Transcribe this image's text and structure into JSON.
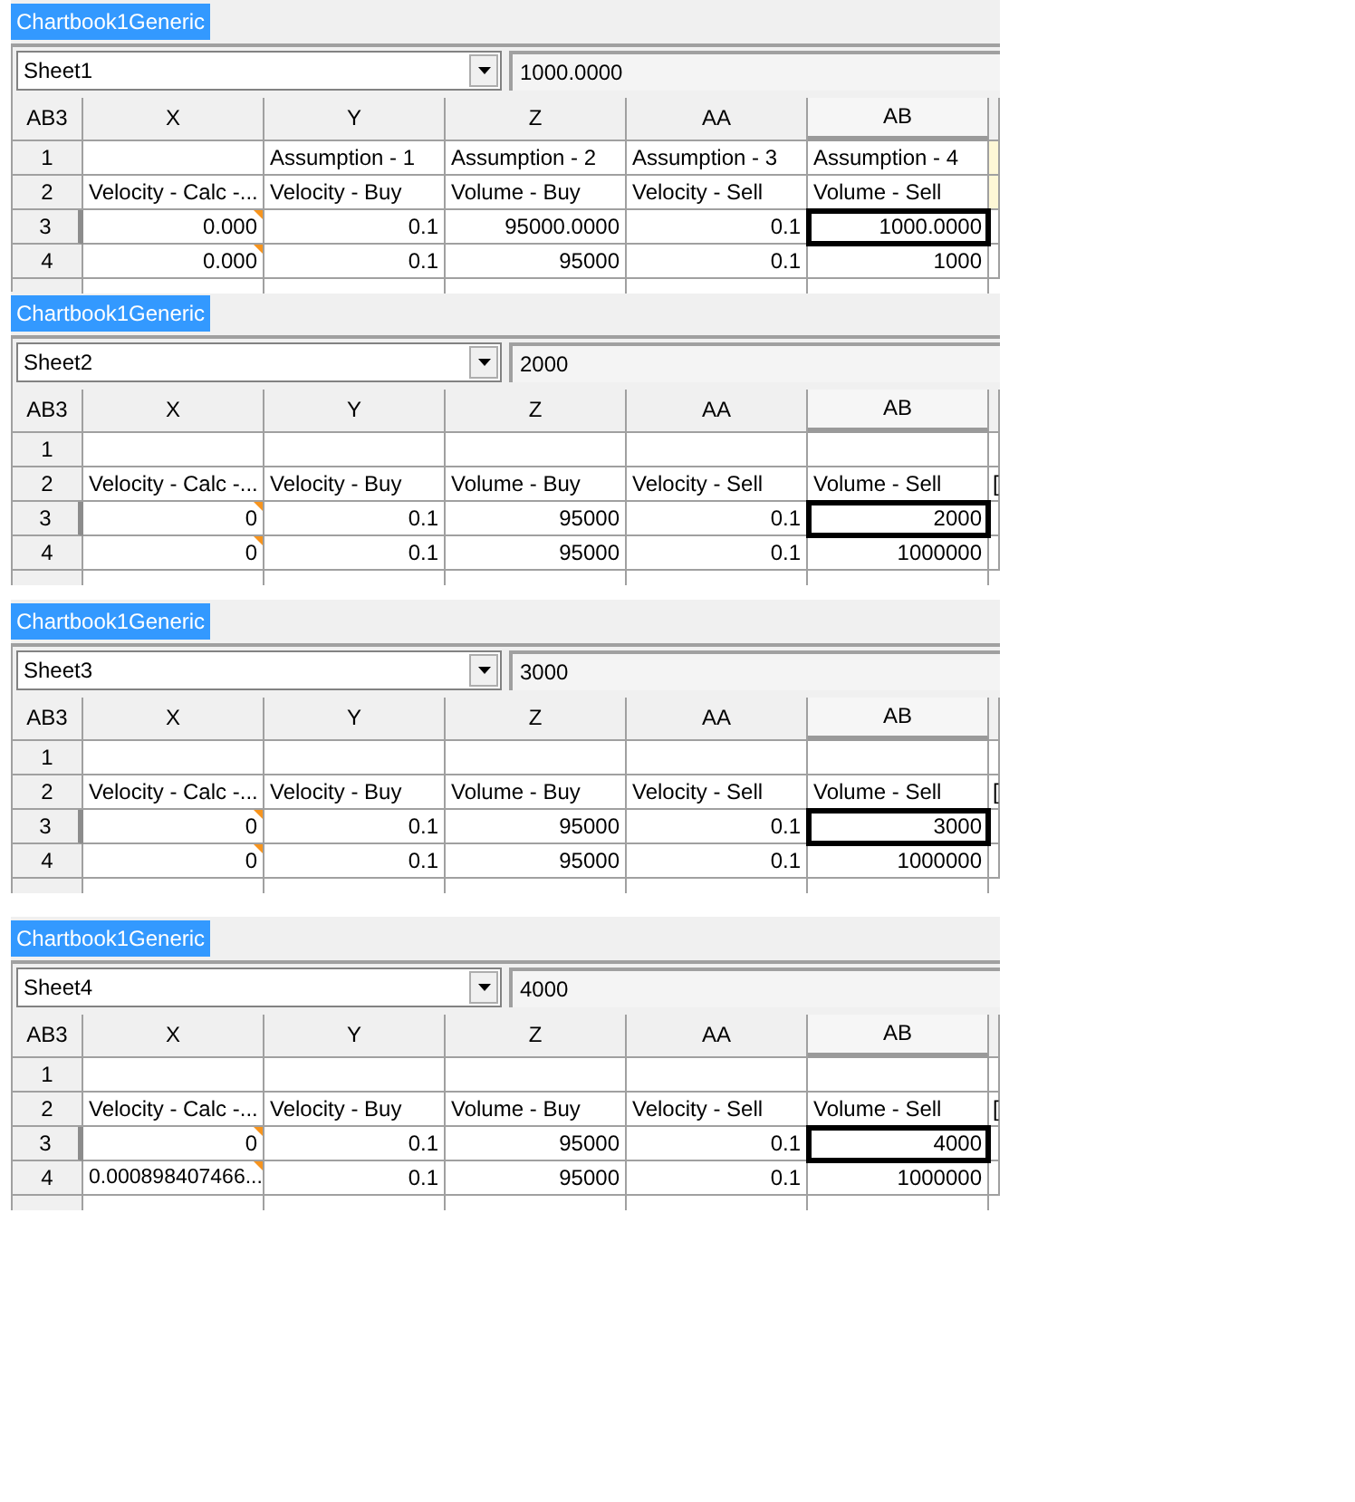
{
  "panels": [
    {
      "tab": {
        "label": "Chartbook1Generic",
        "selected": true
      },
      "sheet_selector": {
        "value": "Sheet1"
      },
      "formula_bar": {
        "value": "1000.0000"
      },
      "grid": {
        "cell_reference": "AB3",
        "columns": [
          {
            "label": "X",
            "selected": false
          },
          {
            "label": "Y",
            "selected": false
          },
          {
            "label": "Z",
            "selected": false
          },
          {
            "label": "AA",
            "selected": false
          },
          {
            "label": "AB",
            "selected": true
          },
          {
            "selected": false
          }
        ],
        "rows": [
          {
            "label": "1",
            "kind": "text",
            "selected": false,
            "cells": [
              {
                "marked": false
              },
              {
                "text": "Assumption - 1",
                "marked": false
              },
              {
                "text": "Assumption - 2",
                "marked": false
              },
              {
                "text": "Assumption - 3",
                "marked": false
              },
              {
                "text": "Assumption - 4",
                "marked": false
              },
              {
                "marked": false,
                "color": "#fdf7d6"
              }
            ]
          },
          {
            "label": "2",
            "kind": "text",
            "selected": false,
            "cells": [
              {
                "text": "Velocity - Calc -...",
                "marked": false
              },
              {
                "text": "Velocity - Buy",
                "marked": false
              },
              {
                "text": "Volume - Buy",
                "marked": false
              },
              {
                "text": "Velocity - Sell",
                "marked": false
              },
              {
                "text": "Volume - Sell",
                "marked": false
              },
              {
                "marked": false,
                "color": "#fdf7d6"
              }
            ]
          },
          {
            "label": "3",
            "kind": "number",
            "selected": true,
            "cells": [
              {
                "text": "0.000",
                "marked": true
              },
              {
                "text": "0.1",
                "marked": false
              },
              {
                "text": "95000.0000",
                "marked": false
              },
              {
                "text": "0.1",
                "marked": false
              },
              {
                "text": "1000.0000",
                "marked": false
              },
              {
                "marked": false
              }
            ]
          },
          {
            "label": "4",
            "kind": "number",
            "selected": false,
            "cells": [
              {
                "text": "0.000",
                "marked": true
              },
              {
                "text": "0.1",
                "marked": false
              },
              {
                "text": "95000",
                "marked": false
              },
              {
                "text": "0.1",
                "marked": false
              },
              {
                "text": "1000",
                "marked": false
              },
              {
                "marked": false
              }
            ]
          }
        ]
      }
    },
    {
      "tab": {
        "label": "Chartbook1Generic",
        "selected": true
      },
      "sheet_selector": {
        "value": "Sheet2"
      },
      "formula_bar": {
        "value": "2000"
      },
      "grid": {
        "cell_reference": "AB3",
        "columns": [
          {
            "label": "X",
            "selected": false
          },
          {
            "label": "Y",
            "selected": false
          },
          {
            "label": "Z",
            "selected": false
          },
          {
            "label": "AA",
            "selected": false
          },
          {
            "label": "AB",
            "selected": true
          },
          {
            "selected": false
          }
        ],
        "rows": [
          {
            "label": "1",
            "kind": "text",
            "selected": false,
            "cells": [
              {
                "marked": false
              },
              {
                "marked": false
              },
              {
                "marked": false
              },
              {
                "marked": false
              },
              {
                "marked": false
              },
              {
                "marked": false
              }
            ]
          },
          {
            "label": "2",
            "kind": "text",
            "selected": false,
            "cells": [
              {
                "text": "Velocity - Calc -...",
                "marked": false
              },
              {
                "text": "Velocity - Buy",
                "marked": false
              },
              {
                "text": "Volume - Buy",
                "marked": false
              },
              {
                "text": "Velocity - Sell",
                "marked": false
              },
              {
                "text": "Volume - Sell",
                "marked": false
              },
              {
                "text": "[",
                "marked": false
              }
            ]
          },
          {
            "label": "3",
            "kind": "number",
            "selected": true,
            "cells": [
              {
                "text": "0",
                "marked": true
              },
              {
                "text": "0.1",
                "marked": false
              },
              {
                "text": "95000",
                "marked": false
              },
              {
                "text": "0.1",
                "marked": false
              },
              {
                "text": "2000",
                "marked": false
              },
              {
                "marked": false
              }
            ]
          },
          {
            "label": "4",
            "kind": "number",
            "selected": false,
            "cells": [
              {
                "text": "0",
                "marked": true
              },
              {
                "text": "0.1",
                "marked": false
              },
              {
                "text": "95000",
                "marked": false
              },
              {
                "text": "0.1",
                "marked": false
              },
              {
                "text": "1000000",
                "marked": false
              },
              {
                "marked": false
              }
            ]
          }
        ]
      }
    },
    {
      "tab": {
        "label": "Chartbook1Generic",
        "selected": true
      },
      "sheet_selector": {
        "value": "Sheet3"
      },
      "formula_bar": {
        "value": "3000"
      },
      "grid": {
        "cell_reference": "AB3",
        "columns": [
          {
            "label": "X",
            "selected": false
          },
          {
            "label": "Y",
            "selected": false
          },
          {
            "label": "Z",
            "selected": false
          },
          {
            "label": "AA",
            "selected": false
          },
          {
            "label": "AB",
            "selected": true
          },
          {
            "selected": false
          }
        ],
        "rows": [
          {
            "label": "1",
            "kind": "text",
            "selected": false,
            "cells": [
              {
                "marked": false
              },
              {
                "marked": false
              },
              {
                "marked": false
              },
              {
                "marked": false
              },
              {
                "marked": false
              },
              {
                "marked": false
              }
            ]
          },
          {
            "label": "2",
            "kind": "text",
            "selected": false,
            "cells": [
              {
                "text": "Velocity - Calc -...",
                "marked": false
              },
              {
                "text": "Velocity - Buy",
                "marked": false
              },
              {
                "text": "Volume - Buy",
                "marked": false
              },
              {
                "text": "Velocity - Sell",
                "marked": false
              },
              {
                "text": "Volume - Sell",
                "marked": false
              },
              {
                "text": "[",
                "marked": false
              }
            ]
          },
          {
            "label": "3",
            "kind": "number",
            "selected": true,
            "cells": [
              {
                "text": "0",
                "marked": true
              },
              {
                "text": "0.1",
                "marked": false
              },
              {
                "text": "95000",
                "marked": false
              },
              {
                "text": "0.1",
                "marked": false
              },
              {
                "text": "3000",
                "marked": false
              },
              {
                "marked": false
              }
            ]
          },
          {
            "label": "4",
            "kind": "number",
            "selected": false,
            "cells": [
              {
                "text": "0",
                "marked": true
              },
              {
                "text": "0.1",
                "marked": false
              },
              {
                "text": "95000",
                "marked": false
              },
              {
                "text": "0.1",
                "marked": false
              },
              {
                "text": "1000000",
                "marked": false
              },
              {
                "marked": false
              }
            ]
          }
        ]
      }
    },
    {
      "tab": {
        "label": "Chartbook1Generic",
        "selected": true
      },
      "sheet_selector": {
        "value": "Sheet4"
      },
      "formula_bar": {
        "value": "4000"
      },
      "grid": {
        "cell_reference": "AB3",
        "columns": [
          {
            "label": "X",
            "selected": false
          },
          {
            "label": "Y",
            "selected": false
          },
          {
            "label": "Z",
            "selected": false
          },
          {
            "label": "AA",
            "selected": false
          },
          {
            "label": "AB",
            "selected": true
          },
          {
            "selected": false
          }
        ],
        "rows": [
          {
            "label": "1",
            "kind": "text",
            "selected": false,
            "cells": [
              {
                "marked": false
              },
              {
                "marked": false
              },
              {
                "marked": false
              },
              {
                "marked": false
              },
              {
                "marked": false
              },
              {
                "marked": false
              }
            ]
          },
          {
            "label": "2",
            "kind": "text",
            "selected": false,
            "cells": [
              {
                "text": "Velocity - Calc -...",
                "marked": false
              },
              {
                "text": "Velocity - Buy",
                "marked": false
              },
              {
                "text": "Volume - Buy",
                "marked": false
              },
              {
                "text": "Velocity - Sell",
                "marked": false
              },
              {
                "text": "Volume - Sell",
                "marked": false
              },
              {
                "text": "[",
                "marked": false
              }
            ]
          },
          {
            "label": "3",
            "kind": "number",
            "selected": true,
            "cells": [
              {
                "text": "0",
                "marked": true
              },
              {
                "text": "0.1",
                "marked": false
              },
              {
                "text": "95000",
                "marked": false
              },
              {
                "text": "0.1",
                "marked": false
              },
              {
                "text": "4000",
                "marked": false
              },
              {
                "marked": false
              }
            ]
          },
          {
            "label": "4",
            "kind": "number",
            "selected": false,
            "cells": [
              {
                "text": "0.000898407466...",
                "marked": true
              },
              {
                "text": "0.1",
                "marked": false
              },
              {
                "text": "95000",
                "marked": false
              },
              {
                "text": "0.1",
                "marked": false
              },
              {
                "text": "1000000",
                "marked": false
              },
              {
                "marked": false
              }
            ]
          }
        ]
      }
    }
  ]
}
